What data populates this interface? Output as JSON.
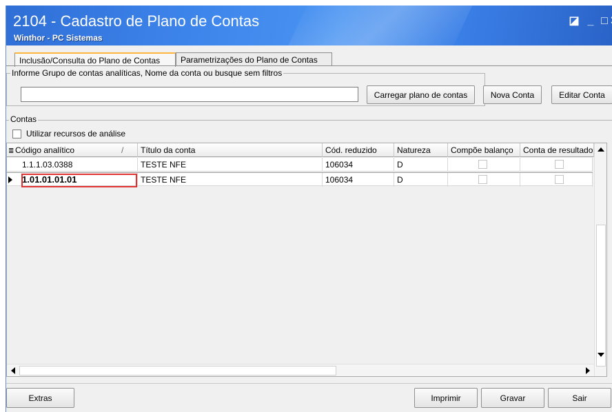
{
  "window": {
    "title": "2104 - Cadastro de Plano de Contas",
    "subtitle": "Winthor - PC Sistemas",
    "controls": {
      "restore": "◪",
      "minimize": "_",
      "maximize": "□",
      "close": "✕"
    }
  },
  "tabs": [
    {
      "label": "Inclusão/Consulta do Plano de Contas",
      "active": true
    },
    {
      "label": "Parametrizações do Plano de Contas",
      "active": false
    }
  ],
  "search": {
    "legend": "Informe Grupo de contas analíticas, Nome da conta ou busque sem filtros",
    "value": "",
    "load_button": "Carregar plano de contas"
  },
  "actions": {
    "new_account": "Nova Conta",
    "edit_account": "Editar Conta"
  },
  "contas": {
    "legend": "Contas",
    "analysis_checkbox_label": "Utilizar recursos de análise",
    "analysis_checked": false
  },
  "grid": {
    "columns": [
      "Código analítico",
      "Título da conta",
      "Cód. reduzido",
      "Natureza",
      "Compõe balanço",
      "Conta de resultado"
    ],
    "sort_indicator": "/",
    "rows": [
      {
        "codigo": "1.1.1.03.0388",
        "titulo": "TESTE NFE",
        "reduzido": "106034",
        "natureza": "D",
        "compoe_balanco": false,
        "conta_resultado": false
      },
      {
        "codigo": "1.01.01.01.01",
        "titulo": "TESTE NFE",
        "reduzido": "106034",
        "natureza": "D",
        "compoe_balanco": false,
        "conta_resultado": false,
        "selected": true
      }
    ]
  },
  "footer": {
    "extras": "Extras",
    "print": "Imprimir",
    "save": "Gravar",
    "exit": "Sair"
  },
  "colors": {
    "titlebar": "#3d84ea",
    "highlight": "#e03030",
    "tab_accent": "#ffb43c"
  }
}
